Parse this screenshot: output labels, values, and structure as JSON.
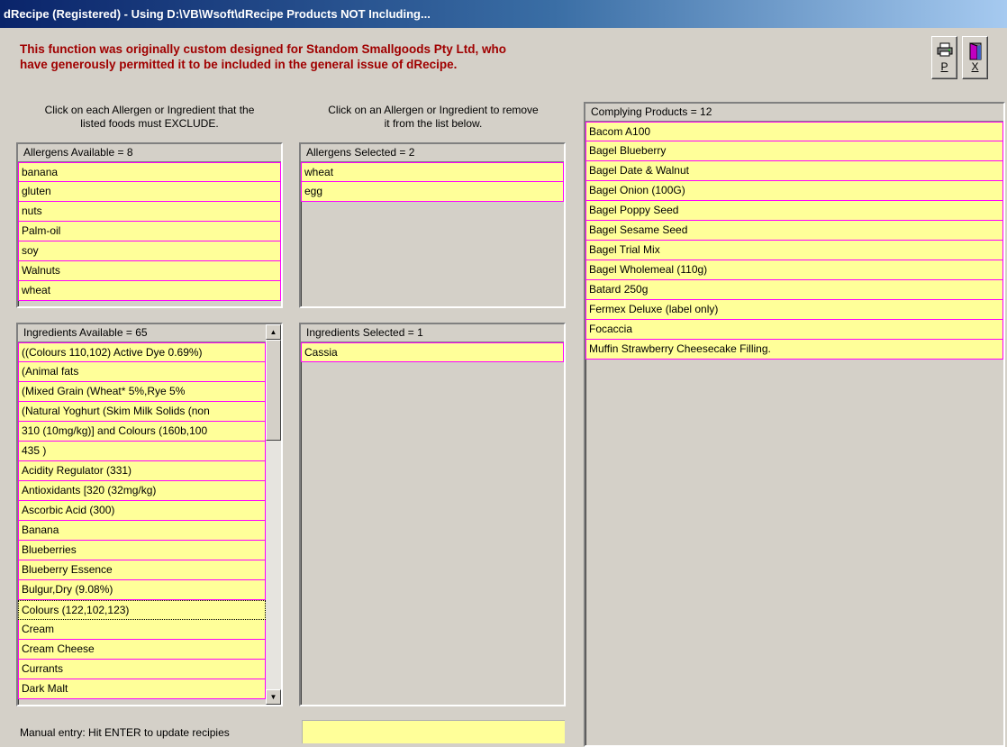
{
  "window": {
    "title": "dRecipe (Registered) - Using D:\\VB\\Wsoft\\dRecipe  Products NOT Including..."
  },
  "notice": {
    "line1": "This function was originally custom designed for Standom Smallgoods Pty Ltd, who",
    "line2": "have generously permitted it to be included in the general issue of dRecipe."
  },
  "toolbar": {
    "print_key": "P",
    "exit_key": "X",
    "print_icon": "printer-icon",
    "exit_icon": "door-exit-icon"
  },
  "instructions": {
    "left_line1": "Click on each Allergen or Ingredient that the",
    "left_line2": "listed foods must EXCLUDE.",
    "mid_line1": "Click on an Allergen or Ingredient to remove",
    "mid_line2": "it from the list below."
  },
  "allergens_available": {
    "header": "Allergens Available = 8",
    "items": [
      "banana",
      "gluten",
      "nuts",
      "Palm-oil",
      "soy",
      "Walnuts",
      "wheat"
    ]
  },
  "allergens_selected": {
    "header": "Allergens Selected = 2",
    "items": [
      "wheat",
      "egg"
    ]
  },
  "ingredients_available": {
    "header": "Ingredients Available = 65",
    "items": [
      "((Colours 110,102) Active Dye 0.69%)",
      "(Animal fats",
      "(Mixed Grain (Wheat* 5%,Rye 5%",
      "(Natural Yoghurt (Skim Milk Solids (non",
      "310 (10mg/kg)] and Colours (160b,100",
      "435 )",
      "Acidity Regulator (331)",
      "Antioxidants [320 (32mg/kg)",
      "Ascorbic Acid (300)",
      "Banana",
      "Blueberries",
      "Blueberry Essence",
      "Bulgur,Dry (9.08%)",
      "Colours (122,102,123)",
      "Cream",
      "Cream Cheese",
      "Currants",
      "Dark Malt"
    ],
    "focused_index": 13
  },
  "ingredients_selected": {
    "header": "Ingredients Selected = 1",
    "items": [
      "Cassia"
    ]
  },
  "complying_products": {
    "header": "Complying Products = 12",
    "items": [
      "Bacom A100",
      "Bagel Blueberry",
      "Bagel Date & Walnut",
      "Bagel Onion (100G)",
      "Bagel Poppy Seed",
      "Bagel Sesame Seed",
      "Bagel Trial Mix",
      "Bagel Wholemeal (110g)",
      "Batard 250g",
      "Fermex Deluxe (label only)",
      "Focaccia",
      "Muffin Strawberry Cheesecake Filling."
    ]
  },
  "manual_entry": {
    "label": "Manual entry:  Hit ENTER to update recipies",
    "value": ""
  },
  "colors": {
    "list_bg": "#ffff99",
    "list_border": "#ff00ff",
    "notice_text": "#a00000"
  }
}
